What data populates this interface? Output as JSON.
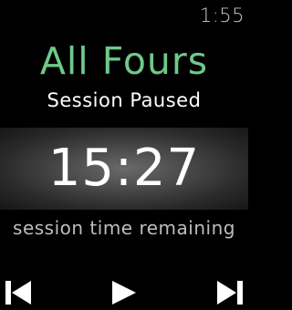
{
  "status_bar": {
    "time": "1:55"
  },
  "workout": {
    "exercise_name": "All Fours",
    "session_status": "Session Paused",
    "timer": "15:27",
    "timer_caption": "session time remaining"
  },
  "controls": {
    "previous_icon": "skip-previous-icon",
    "play_icon": "play-icon",
    "next_icon": "skip-next-icon"
  },
  "colors": {
    "background": "#000000",
    "accent_green": "#6ec98a",
    "text_primary": "#ffffff",
    "text_secondary": "#bdbdbd"
  }
}
